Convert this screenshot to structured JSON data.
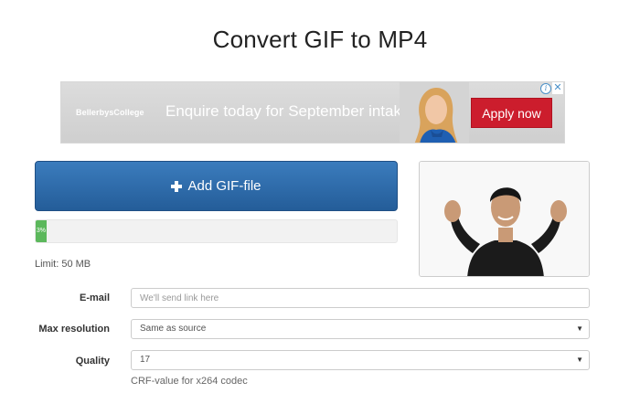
{
  "header": {
    "title": "Convert GIF to MP4"
  },
  "ad": {
    "brand": "BellerbysCollege",
    "message": "Enquire today for September intake",
    "cta": "Apply now",
    "info_icon": "info-icon",
    "close_icon": "close-icon",
    "brand_color": "#cc1d2d"
  },
  "upload": {
    "button_label": "Add GIF-file",
    "button_icon": "plus-icon",
    "progress_percent": 3,
    "progress_label": "3%",
    "limit": "Limit: 50 MB",
    "accent_color": "#2d6cab",
    "progress_color": "#5cb85c"
  },
  "form": {
    "email": {
      "label": "E-mail",
      "placeholder": "We'll send link here"
    },
    "resolution": {
      "label": "Max resolution",
      "value": "Same as source"
    },
    "quality": {
      "label": "Quality",
      "value": "17",
      "help": "CRF-value for x264 codec"
    }
  }
}
